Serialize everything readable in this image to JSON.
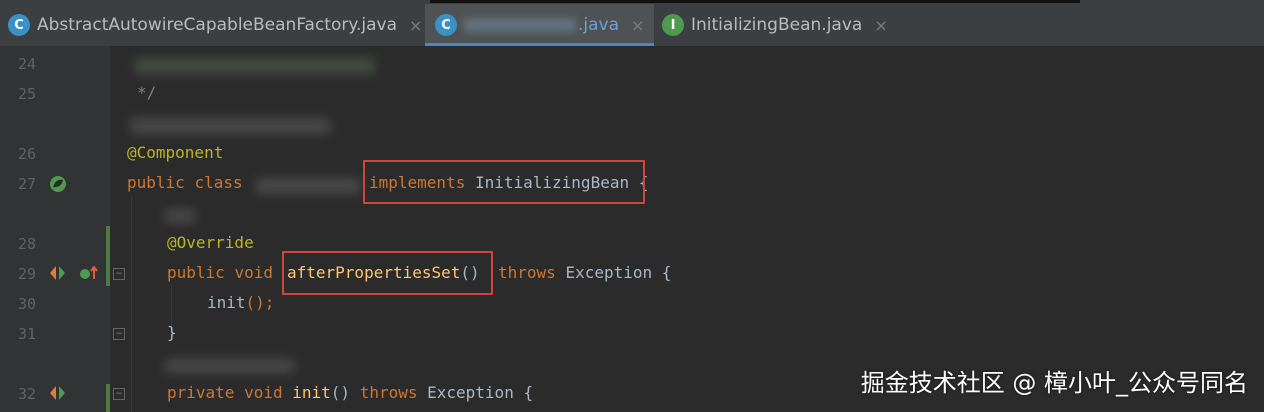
{
  "tabs": [
    {
      "icon": "C",
      "name": "AbstractAutowireCapableBeanFactory.java",
      "close": "×",
      "active": false,
      "color": "#3a91c7"
    },
    {
      "icon": "C",
      "name": ".java",
      "close": "×",
      "active": true,
      "color": "#3a91c7"
    },
    {
      "icon": "I",
      "name": "InitializingBean.java",
      "close": "×",
      "active": false,
      "color": "#4e9a4e"
    }
  ],
  "lines": {
    "n24": "24",
    "n25": "25",
    "n26": "26",
    "n27": "27",
    "n28": "28",
    "n29": "29",
    "n30": "30",
    "n31": "31",
    "n32": "32"
  },
  "code": {
    "comment_end": "*/",
    "annotation_component": "@Component",
    "kw_public": "public",
    "kw_class": "class",
    "kw_implements": "implements",
    "type_initializing_bean": "InitializingBean",
    "brace_open": "{",
    "annotation_override": "@Override",
    "kw_void": "void",
    "method_after_properties_set": "afterPropertiesSet",
    "parens": "()",
    "kw_throws": "throws",
    "type_exception": "Exception",
    "call_init": "init",
    "call_suffix": "();",
    "brace_close": "}",
    "kw_private": "private",
    "method_init": "init"
  },
  "watermark": "掘金技术社区 @ 樟小叶_公众号同名",
  "colors": {
    "keyword": "#cc7832",
    "annotation": "#bbb529",
    "method": "#ffc66d",
    "highlight_box": "#d0453b"
  }
}
